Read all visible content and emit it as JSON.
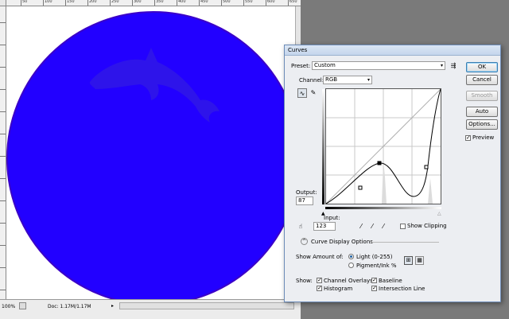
{
  "document": {
    "ruler_labels": [
      "50",
      "100",
      "150",
      "200",
      "250",
      "300",
      "350",
      "400",
      "450",
      "500",
      "550",
      "600",
      "650"
    ],
    "zoom": "100%",
    "doc_info": "Doc: 1.17M/1.17M",
    "colors": {
      "circle": "#2200ff",
      "circle_edge": "#3a00c8",
      "dolphin": "#3018e6"
    }
  },
  "dialog": {
    "title": "Curves",
    "preset_label": "Preset:",
    "preset_value": "Custom",
    "channel_label": "Channel:",
    "channel_value": "RGB",
    "output_label": "Output:",
    "output_value": "87",
    "input_label": "Input:",
    "input_value": "123",
    "show_clipping_label": "Show Clipping",
    "curve_display_options": "Curve Display Options",
    "show_amount_label": "Show Amount of:",
    "light_label": "Light  (0-255)",
    "pigment_label": "Pigment/Ink %",
    "show_label": "Show:",
    "channel_overlays_label": "Channel Overlays",
    "baseline_label": "Baseline",
    "histogram_label": "Histogram",
    "intersection_line_label": "Intersection Line",
    "buttons": {
      "ok": "OK",
      "cancel": "Cancel",
      "smooth": "Smooth",
      "auto": "Auto",
      "options": "Options..."
    },
    "preview_label": "Preview",
    "checkmark": "✓",
    "states": {
      "preview": true,
      "show_clipping": false,
      "channel_overlays": true,
      "baseline": true,
      "histogram": true,
      "intersection_line": true,
      "light_selected": true
    }
  }
}
